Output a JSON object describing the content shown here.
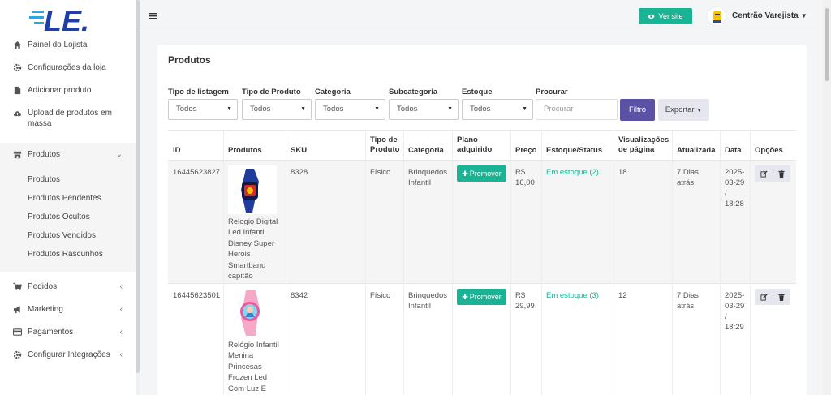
{
  "brand": {
    "logo_text": "LE."
  },
  "sidebar": {
    "items": [
      {
        "label": "Painel do Lojista",
        "icon": "home-icon"
      },
      {
        "label": "Configurações da loja",
        "icon": "gear-icon"
      },
      {
        "label": "Adicionar produto",
        "icon": "file-icon"
      },
      {
        "label": "Upload de produtos em massa",
        "icon": "cloud-upload-icon"
      },
      {
        "label": "Produtos",
        "icon": "shop-icon"
      },
      {
        "label": "Pedidos",
        "icon": "cart-icon"
      },
      {
        "label": "Marketing",
        "icon": "megaphone-icon"
      },
      {
        "label": "Pagamentos",
        "icon": "credit-card-icon"
      },
      {
        "label": "Configurar Integrações",
        "icon": "gear-icon"
      }
    ],
    "submenu": [
      "Produtos",
      "Produtos Pendentes",
      "Produtos Ocultos",
      "Produtos Vendidos",
      "Produtos Rascunhos"
    ]
  },
  "topbar": {
    "view_site": "Ver site",
    "user_name": "Centrão Varejista"
  },
  "page": {
    "title": "Produtos"
  },
  "filters": {
    "listing_label": "Tipo de listagem",
    "listing_value": "Todos",
    "product_type_label": "Tipo de Produto",
    "product_type_value": "Todos",
    "category_label": "Categoria",
    "category_value": "Todos",
    "subcategory_label": "Subcategoria",
    "subcategory_value": "Todos",
    "stock_label": "Estoque",
    "stock_value": "Todos",
    "search_label": "Procurar",
    "search_placeholder": "Procurar",
    "filter_button": "Filtro",
    "export_button": "Exportar"
  },
  "table": {
    "headers": {
      "id": "ID",
      "products": "Produtos",
      "sku": "SKU",
      "type": "Tipo de Produto",
      "category": "Categoria",
      "plan": "Plano adquirido",
      "price": "Preço",
      "stock": "Estoque/Status",
      "views": "Visualizações de página",
      "updated": "Atualizada",
      "date": "Data",
      "options": "Opções"
    },
    "rows": [
      {
        "id": "16445623827",
        "name": "Relogio Digital Led Infantil Disney Super Herois Smartband capitão",
        "sku": "8328",
        "type": "Físico",
        "category": "Brinquedos Infantil",
        "promote": "Promover",
        "price": "R$ 16,00",
        "stock": "Em estoque (2)",
        "views": "18",
        "updated": "7 Dias atrás",
        "date": "2025-03-29 / 18:28"
      },
      {
        "id": "16445623501",
        "name": "Relógio Infantil Menina Princesas Frozen Led Com Luz E Som",
        "sku": "8342",
        "type": "Físico",
        "category": "Brinquedos Infantil",
        "promote": "Promover",
        "price": "R$ 29,99",
        "stock": "Em estoque (3)",
        "views": "12",
        "updated": "7 Dias atrás",
        "date": "2025-03-29 / 18:29"
      }
    ]
  },
  "colors": {
    "accent": "#1ab394",
    "primary": "#5b52a3",
    "logo_blue": "#1f3fa8"
  }
}
